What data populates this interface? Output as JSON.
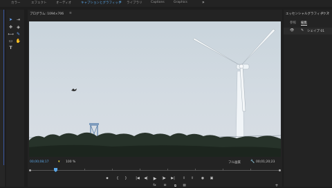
{
  "workspace_tabs": [
    {
      "label": "カラー",
      "active": false
    },
    {
      "label": "エフェクト",
      "active": false
    },
    {
      "label": "オーディオ",
      "active": false
    },
    {
      "label": "キャプションとグラフィック",
      "active": true
    },
    {
      "label": "≡",
      "active": true
    },
    {
      "label": "ライブラリ",
      "active": false
    },
    {
      "label": "Captions",
      "active": false
    },
    {
      "label": "Graphics",
      "active": false
    }
  ],
  "workspace_more": "»",
  "tools": [
    {
      "icon": "selection-arrow-icon",
      "glyph": "➤"
    },
    {
      "icon": "track-select-icon",
      "glyph": "⇥"
    },
    {
      "icon": "ripple-edit-icon",
      "glyph": "✥"
    },
    {
      "icon": "razor-icon",
      "glyph": "◈"
    },
    {
      "icon": "slip-icon",
      "glyph": "⟷"
    },
    {
      "icon": "pen-icon",
      "glyph": "✎"
    },
    {
      "icon": "rectangle-icon",
      "glyph": "▭"
    },
    {
      "icon": "hand-icon",
      "glyph": "✋"
    },
    {
      "icon": "type-icon",
      "glyph": "T"
    }
  ],
  "monitor": {
    "title": "プログラム: 1094×706",
    "menu_glyph": "≡",
    "timecode_current": "00;00;08;17",
    "fit_label": "100 %",
    "quality_label": "フル画質",
    "timecode_duration": "00;01;20;23",
    "settings_glyph": "🔧",
    "marker_glyph": "▾"
  },
  "transport": [
    {
      "icon": "add-marker-icon",
      "glyph": "⬥"
    },
    {
      "icon": "mark-in-icon",
      "glyph": "{"
    },
    {
      "icon": "mark-out-icon",
      "glyph": "}"
    },
    {
      "icon": "go-to-in-icon",
      "glyph": "|◀"
    },
    {
      "icon": "step-back-icon",
      "glyph": "◀|"
    },
    {
      "icon": "play-icon",
      "glyph": "▶"
    },
    {
      "icon": "step-forward-icon",
      "glyph": "|▶"
    },
    {
      "icon": "go-to-out-icon",
      "glyph": "▶|"
    },
    {
      "icon": "lift-icon",
      "glyph": "⇧"
    },
    {
      "icon": "extract-icon",
      "glyph": "⇪"
    },
    {
      "icon": "export-frame-icon",
      "glyph": "◉"
    },
    {
      "icon": "comparison-view-icon",
      "glyph": "▣"
    },
    {
      "icon": "add-button-icon",
      "glyph": "+"
    }
  ],
  "transport_row2": [
    {
      "icon": "fx-icon",
      "glyph": "fx"
    },
    {
      "icon": "safe-margins-icon",
      "glyph": "⊡"
    },
    {
      "icon": "multi-cam-icon",
      "glyph": "⧉"
    },
    {
      "icon": "vr-video-icon",
      "glyph": "▤"
    }
  ],
  "right_panel": {
    "title": "エッセンシャルグラフィックス",
    "menu_glyph": "≡",
    "more_glyph": "»",
    "tabs": [
      {
        "label": "参照",
        "active": false
      },
      {
        "label": "編集",
        "active": true
      }
    ],
    "layer_name": "シェイプ 01"
  }
}
